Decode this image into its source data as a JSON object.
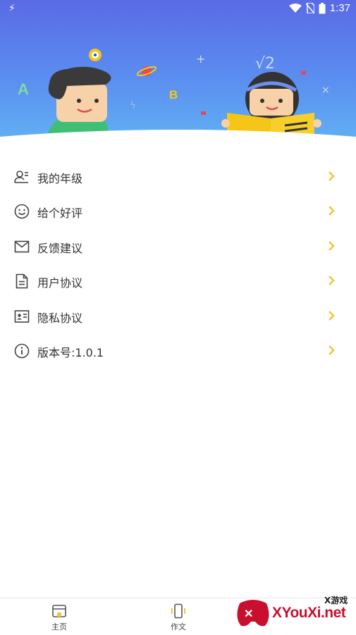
{
  "status_bar": {
    "time": "1:37"
  },
  "menu": [
    {
      "label": "我的年级",
      "icon": "user-grade-icon"
    },
    {
      "label": "给个好评",
      "icon": "smiley-icon"
    },
    {
      "label": "反馈建议",
      "icon": "mail-icon"
    },
    {
      "label": "用户协议",
      "icon": "document-icon"
    },
    {
      "label": "隐私协议",
      "icon": "id-card-icon"
    },
    {
      "label": "版本号:1.0.1",
      "icon": "info-icon"
    }
  ],
  "tabs": [
    {
      "label": "主页",
      "icon": "home-icon"
    },
    {
      "label": "作文",
      "icon": "phone-icon"
    }
  ],
  "watermark": {
    "brand": "XYouXi.net",
    "tag": "X游戏"
  },
  "colors": {
    "header_top": "#5a6ae6",
    "header_bottom": "#62b4f4",
    "chevron": "#f2c53d",
    "icon": "#444444",
    "tab_active": "#f2c53d"
  }
}
